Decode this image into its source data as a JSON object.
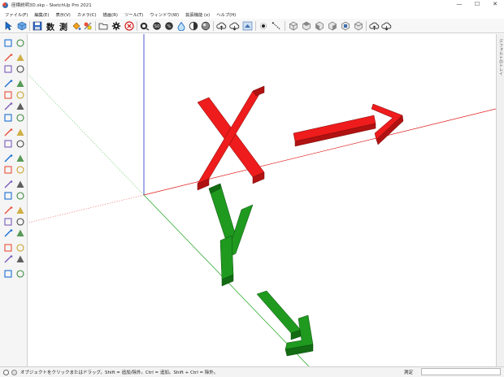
{
  "window": {
    "title": "座標説明3D.skp - SketchUp Pro 2021",
    "minimize_glyph": "—",
    "maximize_glyph": "☐",
    "close_glyph": "✕"
  },
  "menu": [
    {
      "label": "ファイル(F)"
    },
    {
      "label": "編集(E)"
    },
    {
      "label": "表示(V)"
    },
    {
      "label": "カメラ(C)"
    },
    {
      "label": "描画(R)"
    },
    {
      "label": "ツール(T)"
    },
    {
      "label": "ウィンドウ(W)"
    },
    {
      "label": "拡張機能 (x)"
    },
    {
      "label": "ヘルプ(H)"
    }
  ],
  "toolbar": {
    "dim_label": "数",
    "measure_label": "測",
    "icons": [
      "select-icon",
      "component-icon",
      "save-icon",
      "dimension-icon",
      "tape-measure-icon",
      "paint-icon",
      "folder-icon",
      "settings-icon",
      "error-icon",
      "stamp-icon",
      "sandbox-icon",
      "scale-icon",
      "water-icon",
      "shade-icon",
      "styles-icon",
      "cloud-upload-icon",
      "cloud-download-icon",
      "layers-icon",
      "dot-icon",
      "line-icon",
      "view-iso-icon",
      "view-top-icon",
      "view-front-icon",
      "view-right-icon",
      "view-back-icon",
      "view-left-icon",
      "cloud-share-icon",
      "cloud-sync-icon"
    ]
  },
  "left_tools": [
    "select",
    "component",
    "paint",
    "eraser",
    "line",
    "freehand",
    "rectangle",
    "rotated-rect",
    "circle",
    "polygon",
    "arc",
    "arc-2pt",
    "pie",
    "arc-3pt",
    "push-pull",
    "follow-me",
    "offset",
    "move",
    "rotate",
    "scale",
    "tape-measure",
    "dimension",
    "protractor",
    "text",
    "axes",
    "3d-text",
    "orbit",
    "pan",
    "zoom",
    "zoom-window",
    "zoom-extents",
    "previous",
    "walk",
    "look-around",
    "position-camera",
    "section",
    "sandbox",
    "smoove"
  ],
  "right_tray": {
    "label": "デフォルトのトレイ"
  },
  "status": {
    "text": "オブジェクトをクリックまたはドラッグ。Shift = 追加/除外。Ctrl = 追加。Shift + Ctrl = 除外。",
    "measure_label": "測定",
    "measure_value": ""
  },
  "colors": {
    "x_axis": "#e01b1b",
    "y_axis": "#17a317",
    "z_axis": "#1c2fbf",
    "model_red": "#ee1c1c",
    "model_red_dark": "#b01212",
    "model_green": "#1f9a1f",
    "model_green_dark": "#136b13"
  }
}
